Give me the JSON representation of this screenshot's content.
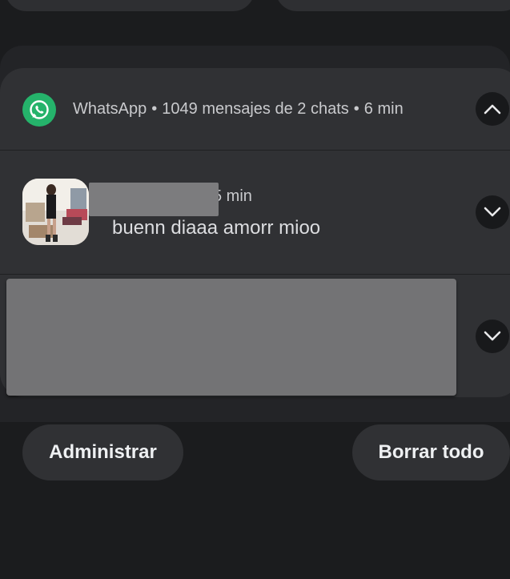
{
  "header": {
    "app_name": "WhatsApp",
    "separator": "•",
    "summary": "1049 mensajes de 2 chats",
    "time": "6 min"
  },
  "notification_1": {
    "time_visible": "5 min",
    "message": "buenn diaaa amorr mioo"
  },
  "actions": {
    "manage_label": "Administrar",
    "clear_all_label": "Borrar todo"
  },
  "colors": {
    "whatsapp_green": "#25b36b",
    "card_bg": "#303134",
    "background": "#1b1c1e"
  },
  "icons": {
    "app": "whatsapp-icon",
    "collapse": "chevron-up-icon",
    "expand": "chevron-down-icon"
  }
}
